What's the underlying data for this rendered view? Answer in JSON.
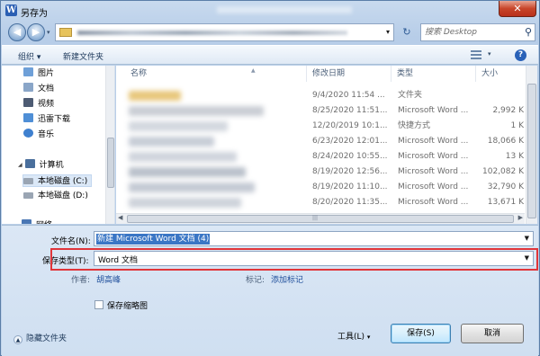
{
  "window": {
    "title": "另存为",
    "close_glyph": "✕"
  },
  "nav_buttons": {
    "back": "◀",
    "forward": "▶",
    "dropdown": "▾"
  },
  "address": {
    "dropdown": "▾",
    "refresh": "↻"
  },
  "search": {
    "placeholder": "搜索 Desktop",
    "icon": "⚲"
  },
  "toolbar": {
    "organize": "组织 ▾",
    "new_folder": "新建文件夹",
    "view_dropdown": "▾",
    "help": "?"
  },
  "nav": {
    "favorites": [
      {
        "label": "图片",
        "icon": "pictures-icon",
        "color": "#6fa0d8"
      },
      {
        "label": "文档",
        "icon": "documents-icon",
        "color": "#8aa6c8"
      },
      {
        "label": "视频",
        "icon": "videos-icon",
        "color": "#4d5b73"
      },
      {
        "label": "迅雷下载",
        "icon": "download-icon",
        "color": "#4f8fd6"
      },
      {
        "label": "音乐",
        "icon": "music-icon",
        "color": "#3f80cf"
      }
    ],
    "computer": "计算机",
    "drives": [
      {
        "label": "本地磁盘 (C:)",
        "icon": "drive-icon"
      },
      {
        "label": "本地磁盘 (D:)",
        "icon": "drive-icon"
      }
    ],
    "network": "网络"
  },
  "columns": {
    "name": "名称",
    "date": "修改日期",
    "type": "类型",
    "size": "大小"
  },
  "rows": [
    {
      "date": "9/4/2020 11:54 ...",
      "type": "文件夹",
      "size": ""
    },
    {
      "date": "8/25/2020 11:51...",
      "type": "Microsoft Word ...",
      "size": "2,992 K"
    },
    {
      "date": "12/20/2019 10:1...",
      "type": "快捷方式",
      "size": "1 K"
    },
    {
      "date": "6/23/2020 12:01...",
      "type": "Microsoft Word ...",
      "size": "18,066 K"
    },
    {
      "date": "8/24/2020 10:55...",
      "type": "Microsoft Word ...",
      "size": "13 K"
    },
    {
      "date": "8/19/2020 12:56...",
      "type": "Microsoft Word ...",
      "size": "102,082 K"
    },
    {
      "date": "8/19/2020 11:10...",
      "type": "Microsoft Word ...",
      "size": "32,790 K"
    },
    {
      "date": "8/20/2020 11:35...",
      "type": "Microsoft Word ...",
      "size": "13,671 K"
    }
  ],
  "form": {
    "file_name_label": "文件名(N):",
    "file_name_value": "新建 Microsoft Word 文档 (4)",
    "file_type_label": "保存类型(T):",
    "file_type_value": "Word 文档",
    "author_label": "作者:",
    "author_value": "胡高峰",
    "tags_label": "标记:",
    "tags_value": "添加标记",
    "thumbnail_label": "保存缩略图",
    "hide_folders": "隐藏文件夹",
    "tools": "工具(L)",
    "save": "保存(S)",
    "cancel": "取消",
    "dropdown": "▼"
  },
  "colors": {
    "highlight_border": "#e0353a",
    "selection": "#3a76c5",
    "link": "#1f4e9b"
  }
}
